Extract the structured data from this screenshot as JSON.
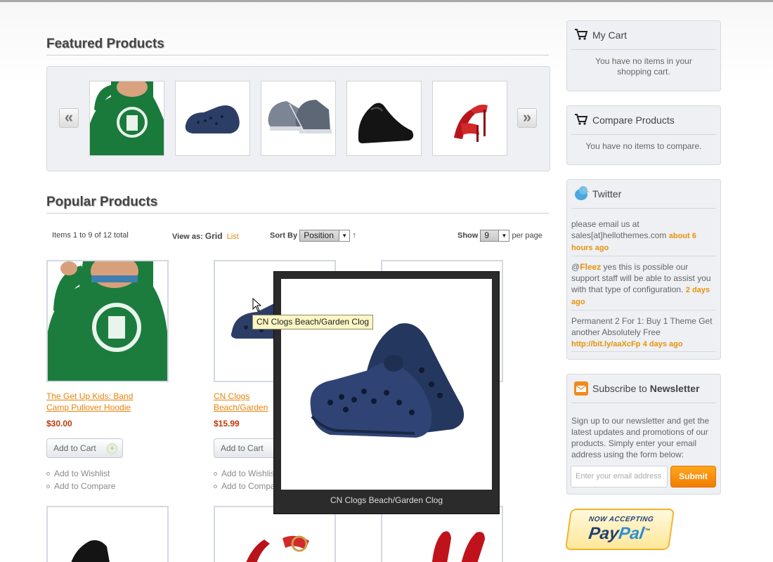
{
  "featured": {
    "title": "Featured Products",
    "prev_label": "«",
    "next_label": "»",
    "thumbs": [
      "green-hoodie",
      "blue-clog",
      "sneakers",
      "black-loafer",
      "red-heels"
    ]
  },
  "popular": {
    "title": "Popular Products",
    "items_count": "Items 1 to 9 of 12 total",
    "view_as_label": "View as:",
    "view_grid": "Grid",
    "view_list": "List",
    "sort_by_label": "Sort By",
    "sort_value": "Position",
    "sort_dir_icon": "↑",
    "show_label": "Show",
    "show_value": "9",
    "per_page": "per page"
  },
  "products": [
    {
      "name": "The Get Up Kids: Band Camp Pullover Hoodie",
      "price": "$30.00",
      "add_to_cart": "Add to Cart",
      "wishlist": "Add to Wishlist",
      "compare": "Add to Compare"
    },
    {
      "name": "CN Clogs Beach/Garden Clog",
      "price": "$15.99",
      "add_to_cart": "Add to Cart",
      "wishlist": "Add to Wishlist",
      "compare": "Add to Compare"
    }
  ],
  "lightbox": {
    "caption": "CN Clogs Beach/Garden Clog"
  },
  "tooltip": "CN Clogs Beach/Garden Clog",
  "sidebar": {
    "cart": {
      "title": "My Cart",
      "text": "You have no items in your shopping cart."
    },
    "compare": {
      "title": "Compare Products",
      "text": "You have no items to compare."
    },
    "twitter": {
      "title": "Twitter",
      "tweets": [
        {
          "text": "please email us at sales[at]hellothemes.com ",
          "time": "about 6 hours ago"
        },
        {
          "prefix": "@",
          "mention": "Fleez",
          "text": " yes this is possible our support staff will be able to assist you with that type of configuration. ",
          "time": "2 days ago"
        },
        {
          "text": "Permanent 2 For 1: Buy 1 Theme Get another Absolutely Free ",
          "link": "http://bit.ly/aaXcFp",
          "time": "4 days ago"
        }
      ]
    },
    "newsletter": {
      "title_prefix": "Subscribe to ",
      "title_bold": "Newsletter",
      "text": "Sign up to our newsletter and get the latest updates and promotions of our products. Simply enter your email address using the form below:",
      "placeholder": "Enter your email address",
      "submit": "Submit"
    },
    "paypal": {
      "top": "NOW ACCEPTING",
      "pay": "Pay",
      "pal": "Pal",
      "tm": "™"
    }
  },
  "colors": {
    "accent_orange": "#e8830b",
    "price_red": "#c0390a",
    "panel_bg": "#eef0f3"
  }
}
